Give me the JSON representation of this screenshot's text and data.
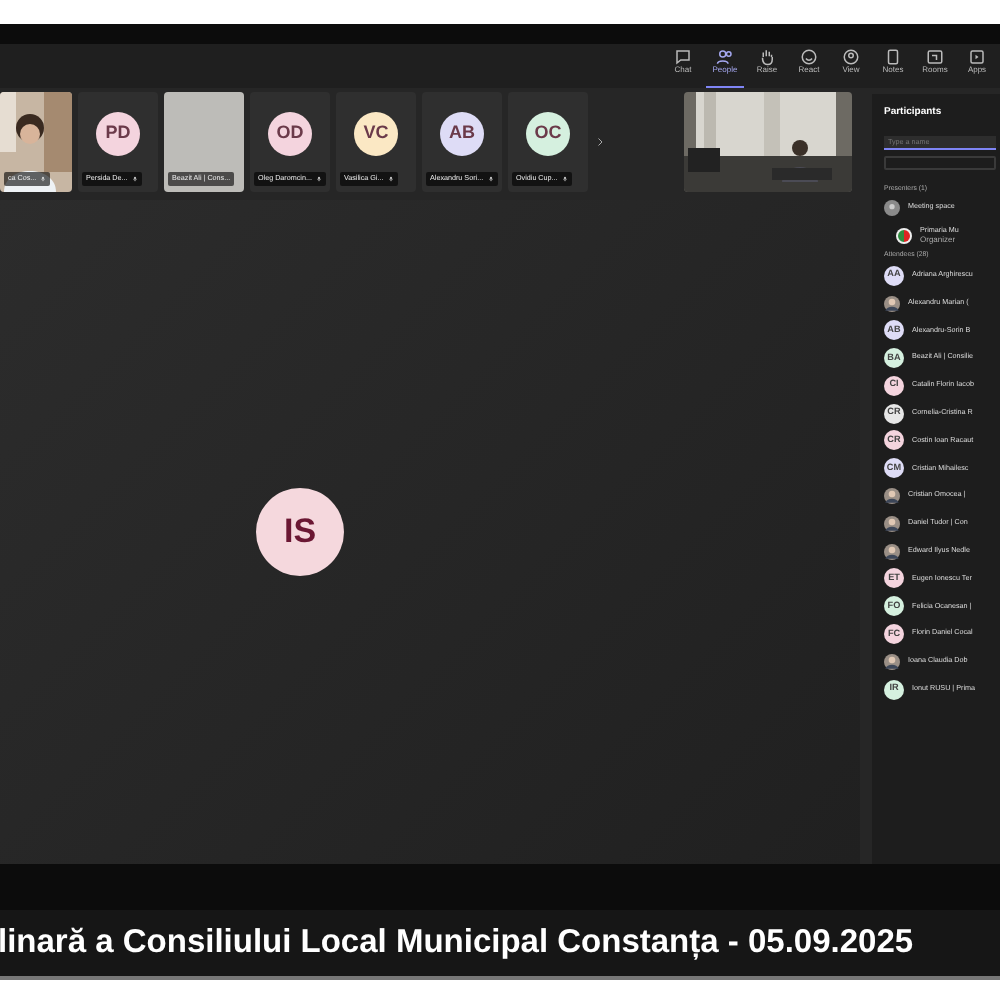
{
  "toolbar": [
    {
      "label": "Chat",
      "kind": "chat",
      "selected": false
    },
    {
      "label": "People",
      "kind": "people",
      "selected": true
    },
    {
      "label": "Raise",
      "kind": "hand",
      "selected": false
    },
    {
      "label": "React",
      "kind": "smile",
      "selected": false
    },
    {
      "label": "View",
      "kind": "view",
      "selected": false
    },
    {
      "label": "Notes",
      "kind": "notes",
      "selected": false
    },
    {
      "label": "Rooms",
      "kind": "rooms",
      "selected": false
    },
    {
      "label": "Apps",
      "kind": "apps",
      "selected": false
    }
  ],
  "tiles": [
    {
      "kind": "video",
      "name": "ca Cos..."
    },
    {
      "kind": "avatar",
      "initials": "PD",
      "name": "Persida De...",
      "color": "#f4d4de"
    },
    {
      "kind": "blank",
      "name": "Beazit Ali | Cons..."
    },
    {
      "kind": "avatar",
      "initials": "OD",
      "name": "Oleg Daromcin...",
      "color": "#f4d4de"
    },
    {
      "kind": "avatar",
      "initials": "VC",
      "name": "Vasilica Gi...",
      "color": "#fbe8c4"
    },
    {
      "kind": "avatar",
      "initials": "AB",
      "name": "Alexandru Sori...",
      "color": "#dedcf6"
    },
    {
      "kind": "avatar",
      "initials": "OC",
      "name": "Ovidiu Cup...",
      "color": "#d5f0df"
    }
  ],
  "stage": {
    "initials": "IS"
  },
  "participants": {
    "title": "Participants",
    "search": {
      "placeholder": "Type a name"
    },
    "presenters_heading": "Presenters (1)",
    "meeting_space": "Meeting space",
    "organizer": {
      "name": "Primaria Mu",
      "role": "Organizer"
    },
    "attendees_heading": "Attendees (28)",
    "attendees": [
      {
        "kind": "initials",
        "initials": "AA",
        "name": "Adriana Arghirescu",
        "color": "#dedcf6"
      },
      {
        "name": "Alexandru Marian ("
      },
      {
        "kind": "initials",
        "initials": "AB",
        "name": "Alexandru-Sorin B",
        "color": "#dedcf6"
      },
      {
        "kind": "initials",
        "initials": "BA",
        "name": "Beazit Ali | Consilie",
        "color": "#d5f0df"
      },
      {
        "kind": "initials",
        "initials": "CI",
        "name": "Catalin Florin Iacob",
        "color": "#f4d4de"
      },
      {
        "kind": "initials",
        "initials": "CR",
        "name": "Cornelia-Cristina R",
        "color": "#e6e6e6"
      },
      {
        "kind": "initials",
        "initials": "CR",
        "name": "Costin Ioan Racaut",
        "color": "#f4d4de"
      },
      {
        "kind": "initials",
        "initials": "CM",
        "name": "Cristian Mihailesc",
        "color": "#dedcf6"
      },
      {
        "name": "Cristian Omocea |"
      },
      {
        "name": "Daniel Tudor | Con"
      },
      {
        "name": "Edward Ilyus Nedle"
      },
      {
        "kind": "initials",
        "initials": "ET",
        "name": "Eugen Ionescu Ter",
        "color": "#f4d4de"
      },
      {
        "kind": "initials",
        "initials": "FO",
        "name": "Felicia Ocanesan |",
        "color": "#d5f0df"
      },
      {
        "kind": "initials",
        "initials": "FC",
        "name": "Florin Daniel Cocal",
        "color": "#f4d4de"
      },
      {
        "name": "Ioana Claudia Dob"
      },
      {
        "kind": "initials",
        "initials": "IR",
        "name": "Ionut RUSU | Prima",
        "color": "#d5f0df"
      }
    ]
  },
  "caption": "linară a Consiliului Local Municipal Constanța - 05.09.2025"
}
